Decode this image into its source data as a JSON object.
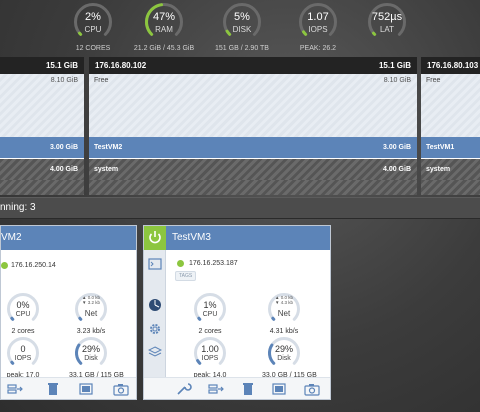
{
  "stats": [
    {
      "value": "2%",
      "label": "CPU",
      "sub": "12 CORES",
      "fraction": 0.02
    },
    {
      "value": "47%",
      "label": "RAM",
      "sub": "21.2 GiB / 45.3 GiB",
      "fraction": 0.47
    },
    {
      "value": "5%",
      "label": "DISK",
      "sub": "151 GB / 2.90 TB",
      "fraction": 0.05
    },
    {
      "value": "1.07",
      "label": "IOPS",
      "sub": "PEAK: 26.2",
      "fraction": 0.04
    },
    {
      "value": "752µs",
      "label": "LAT",
      "sub": "",
      "fraction": 0.0
    }
  ],
  "memory": [
    {
      "host": "",
      "total": "15.1 GiB",
      "free_label": "",
      "free_size": "8.10 GiB",
      "vm_name": "",
      "vm_size": "3.00 GiB",
      "system_label": "",
      "system_size": "4.00 GiB"
    },
    {
      "host": "176.16.80.102",
      "total": "15.1 GiB",
      "free_label": "Free",
      "free_size": "8.10 GiB",
      "vm_name": "TestVM2",
      "vm_size": "3.00 GiB",
      "system_label": "system",
      "system_size": "4.00 GiB"
    },
    {
      "host": "176.16.80.103",
      "total": "",
      "free_label": "Free",
      "free_size": "",
      "vm_name": "TestVM1",
      "vm_size": "",
      "system_label": "system",
      "system_size": ""
    }
  ],
  "running": "nning: 3",
  "cards": [
    {
      "title": "VM2",
      "ip": "176.16.250.14",
      "cpu": {
        "value": "0%",
        "label": "CPU",
        "sub": "2 cores",
        "fraction": 0.0
      },
      "net": {
        "up": "▲ 0.0 kb",
        "down": "▼ 3.2 kb",
        "label": "Net",
        "sub": "3.23 kb/s"
      },
      "iops": {
        "value": "0",
        "label": "IOPS",
        "sub": "peak: 17.0",
        "fraction": 0.0
      },
      "disk": {
        "value": "29%",
        "label": "Disk",
        "sub": "33.1 GB / 115 GB",
        "fraction": 0.29
      }
    },
    {
      "title": "TestVM3",
      "ip": "176.16.253.187",
      "tags": "TAGS",
      "cpu": {
        "value": "1%",
        "label": "CPU",
        "sub": "2 cores",
        "fraction": 0.01
      },
      "net": {
        "up": "▲ 0.0 kb",
        "down": "▼ 4.3 kb",
        "label": "Net",
        "sub": "4.31 kb/s"
      },
      "iops": {
        "value": "1.00",
        "label": "IOPS",
        "sub": "peak: 14.0",
        "fraction": 0.05
      },
      "disk": {
        "value": "29%",
        "label": "Disk",
        "sub": "33.0 GB / 115 GB",
        "fraction": 0.29
      }
    }
  ],
  "colors": {
    "accent": "#5c84b8",
    "power": "#8cc63f",
    "gauge_track": "#d6dde6",
    "gauge_fill": "#5c84b8",
    "top_track": "#6a6a6a",
    "top_fill": "#8cc63f"
  }
}
